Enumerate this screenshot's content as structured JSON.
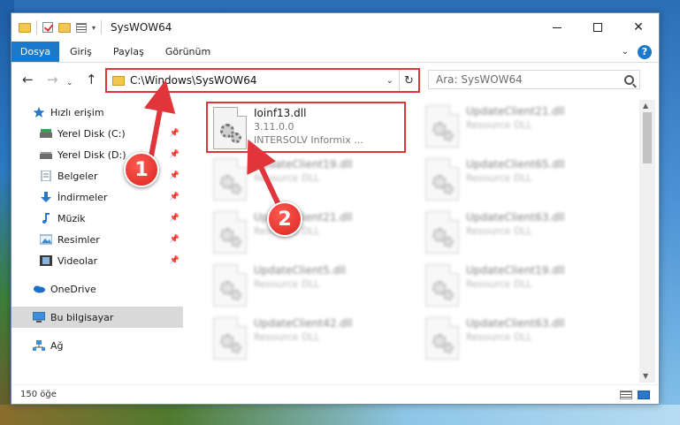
{
  "window": {
    "title": "SysWOW64",
    "controls": {
      "minimize": "—",
      "maximize": "☐",
      "close": "✕"
    }
  },
  "ribbon": {
    "tabs": [
      "Dosya",
      "Giriş",
      "Paylaş",
      "Görünüm"
    ],
    "help": "?"
  },
  "address": {
    "path": "C:\\Windows\\SysWOW64",
    "search_placeholder": "Ara: SysWOW64"
  },
  "nav_pane": {
    "items": [
      {
        "label": "Hızlı erişim",
        "icon": "star-icon"
      },
      {
        "label": "Yerel Disk (C:)",
        "icon": "drive-icon",
        "pinned": true
      },
      {
        "label": "Yerel Disk (D:)",
        "icon": "drive-icon",
        "pinned": true
      },
      {
        "label": "Belgeler",
        "icon": "documents-icon",
        "pinned": true
      },
      {
        "label": "İndirmeler",
        "icon": "download-icon",
        "pinned": true
      },
      {
        "label": "Müzik",
        "icon": "music-icon",
        "pinned": true
      },
      {
        "label": "Resimler",
        "icon": "pictures-icon",
        "pinned": true
      },
      {
        "label": "Videolar",
        "icon": "video-icon",
        "pinned": true
      },
      {
        "label": "OneDrive",
        "icon": "cloud-icon"
      },
      {
        "label": "Bu bilgisayar",
        "icon": "computer-icon",
        "selected": true
      },
      {
        "label": "Ağ",
        "icon": "network-icon"
      }
    ]
  },
  "files": [
    {
      "name": "Ioinf13.dll",
      "line2": "3.11.0.0",
      "line3": "INTERSOLV Informix ...",
      "featured": true
    },
    {
      "name": "UpdateClient21.dll",
      "line2": "Resource DLL"
    },
    {
      "name": "UpdateClient19.dll",
      "line2": "Resource DLL"
    },
    {
      "name": "UpdateClient65.dll",
      "line2": "Resource DLL"
    },
    {
      "name": "UpdateClient21.dll",
      "line2": "Resource DLL"
    },
    {
      "name": "UpdateClient63.dll",
      "line2": "Resource DLL"
    },
    {
      "name": "UpdateClient5.dll",
      "line2": "Resource DLL"
    },
    {
      "name": "UpdateClient19.dll",
      "line2": "Resource DLL"
    },
    {
      "name": "UpdateClient42.dll",
      "line2": "Resource DLL"
    },
    {
      "name": "UpdateClient63.dll",
      "line2": "Resource DLL"
    }
  ],
  "status": {
    "item_count": "150 öğe"
  },
  "annotations": {
    "step1": "1",
    "step2": "2"
  },
  "colors": {
    "accent": "#1979ca",
    "highlight": "#e0353a",
    "selected_bg": "#d9d9d9"
  }
}
